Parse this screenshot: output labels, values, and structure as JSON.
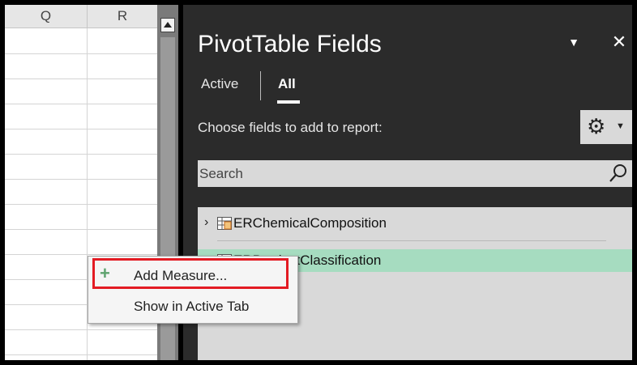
{
  "sheet": {
    "columns": [
      "Q",
      "R"
    ]
  },
  "pane": {
    "title": "PivotTable Fields",
    "tabs": [
      {
        "label": "Active"
      },
      {
        "label": "All"
      }
    ],
    "choose_label": "Choose fields to add to report:",
    "search": {
      "placeholder": "Search"
    },
    "fields": [
      {
        "label": "ERChemicalComposition",
        "expanded": false
      },
      {
        "label": "ERProductClassification",
        "expanded": false
      }
    ]
  },
  "context_menu": {
    "items": [
      {
        "label": "Add Measure...",
        "icon": "plus-icon"
      },
      {
        "label": "Show in Active Tab"
      }
    ]
  },
  "colors": {
    "pane_bg": "#2b2b2b",
    "highlight_row": "#a6dcc0",
    "focus_border": "#e31b23",
    "plus": "#5ea36f"
  }
}
